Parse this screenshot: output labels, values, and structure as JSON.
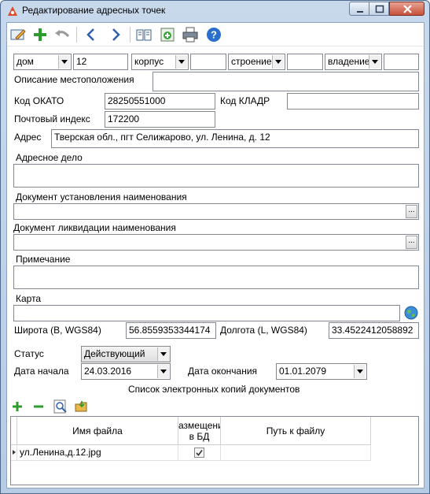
{
  "window": {
    "title": "Редактирование адресных точек",
    "icons": {
      "app": "app-icon",
      "minimize": "minimize-icon",
      "maximize": "maximize-icon",
      "close": "close-icon"
    }
  },
  "toolbar": {
    "icons": [
      "edit-icon",
      "add-icon",
      "undo-icon",
      "back-icon",
      "forward-icon",
      "book-icon",
      "add-record-icon",
      "print-icon",
      "help-icon"
    ]
  },
  "address_parts": {
    "house_type": "дом",
    "house_number": "12",
    "building_type": "корпус",
    "building_number": "",
    "structure_type": "строение",
    "structure_number": "",
    "ownership_type": "владение",
    "ownership_number": ""
  },
  "form": {
    "location_description_label": "Описание местоположения",
    "location_description_value": "",
    "okato_label": "Код ОКАТО",
    "okato_value": "28250551000",
    "kladr_label": "Код КЛАДР",
    "kladr_value": "",
    "postal_label": "Почтовый индекс",
    "postal_value": "172200",
    "address_label": "Адрес",
    "address_value": "Тверская обл., пгт Селижарово, ул. Ленина, д. 12",
    "address_file_label": "Адресное дело",
    "address_file_value": "",
    "doc_naming_label": "Документ установления наименования",
    "doc_naming_value": "",
    "doc_liquidation_label": "Документ ликвидации наименования",
    "doc_liquidation_value": "",
    "note_label": "Примечание",
    "note_value": "",
    "map_label": "Карта",
    "map_value": "",
    "lat_label": "Широта (B, WGS84)",
    "lat_value": "56.8559353344174",
    "lon_label": "Долгота (L, WGS84)",
    "lon_value": "33.4522412058892",
    "status_label": "Статус",
    "status_value": "Действующий",
    "start_date_label": "Дата начала",
    "start_date_value": "24.03.2016",
    "end_date_label": "Дата окончания",
    "end_date_value": "01.01.2079",
    "ellipsis": "..."
  },
  "documents": {
    "title": "Список электронных копий документов",
    "toolbar_icons": [
      "add-icon",
      "remove-icon",
      "preview-icon",
      "open-folder-icon"
    ],
    "columns": [
      "Имя файла",
      "азмещени\nв БД",
      "Путь к файлу"
    ],
    "rows": [
      {
        "file_name": "ул.Ленина,д.12.jpg",
        "stored_in_db": true,
        "path": ""
      }
    ]
  }
}
